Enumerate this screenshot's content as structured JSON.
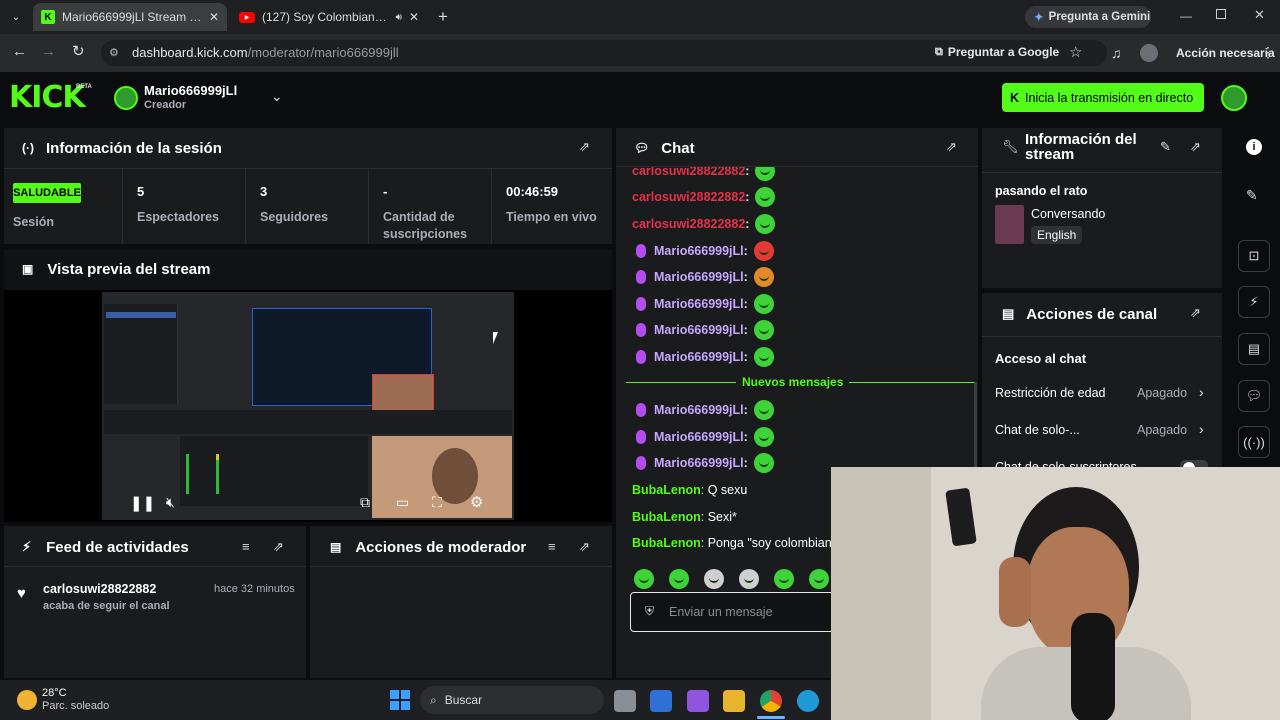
{
  "browser": {
    "tabs": [
      {
        "label": "Mario666999jLl Stream - Kick D"
      },
      {
        "label": "(127) Soy Colombiano -Silv"
      }
    ],
    "gemini": "Pregunta a Gemini",
    "url_host": "dashboard.kick.com",
    "url_path": "/moderator/mario666999jll",
    "ask_google": "Preguntar a Google",
    "action_needed": "Acción necesaria"
  },
  "header": {
    "logo": "KICK",
    "beta": "BETA",
    "channel": "Mario666999jLl",
    "role": "Creador",
    "go_live": "Inicia la transmisión en directo"
  },
  "session": {
    "title": "Información de la sesión",
    "badge": "SALUDABLE",
    "badge_label": "Sesión",
    "stats": [
      {
        "value": "5",
        "label": "Espectadores"
      },
      {
        "value": "3",
        "label": "Seguidores"
      },
      {
        "value": "-",
        "label": "Cantidad de suscripciones"
      },
      {
        "value": "00:46:59",
        "label": "Tiempo en vivo"
      }
    ]
  },
  "preview": {
    "title": "Vista previa del stream"
  },
  "activity": {
    "title": "Feed de actividades",
    "user": "carlosuwi28822882",
    "time": "hace 32 minutos",
    "action": "acaba de seguir el canal"
  },
  "modactions": {
    "title": "Acciones de moderador"
  },
  "chat": {
    "title": "Chat",
    "messages": [
      {
        "user": "carlosuwi28822882",
        "text": ":"
      },
      {
        "user": "carlosuwi28822882",
        "text": ":"
      },
      {
        "user": "carlosuwi28822882",
        "text": ":"
      },
      {
        "user": "Mario666999jLl",
        "text": ":"
      },
      {
        "user": "Mario666999jLl",
        "text": ":"
      },
      {
        "user": "Mario666999jLl",
        "text": ":"
      },
      {
        "user": "Mario666999jLl",
        "text": ":"
      },
      {
        "user": "Mario666999jLl",
        "text": ":"
      }
    ],
    "divider": "Nuevos mensajes",
    "new_messages": [
      {
        "user": "Mario666999jLl",
        "text": ":"
      },
      {
        "user": "Mario666999jLl",
        "text": ":"
      },
      {
        "user": "Mario666999jLl",
        "text": ":"
      },
      {
        "user": "BubaLenon",
        "text": ": Q sexu"
      },
      {
        "user": "BubaLenon",
        "text": ": Sexi*"
      },
      {
        "user": "BubaLenon",
        "text": ": Ponga \"soy colombianc"
      }
    ],
    "placeholder": "Enviar un mensaje"
  },
  "stream_info": {
    "title": "Información del stream",
    "stream_title": "pasando el rato",
    "category": "Conversando",
    "language": "English"
  },
  "channel_actions": {
    "title": "Acciones de canal",
    "section": "Acceso al chat",
    "rows": [
      {
        "label": "Restricción de edad",
        "value": "Apagado"
      },
      {
        "label": "Chat de solo-...",
        "value": "Apagado"
      },
      {
        "label": "Chat de solo-suscriptores",
        "value": ""
      }
    ]
  },
  "taskbar": {
    "temp": "28°C",
    "weather": "Parc. soleado",
    "search": "Buscar"
  },
  "colors": {
    "kick_green": "#53fc18",
    "chat_red": "#e8304a",
    "mod_purple": "#c9a6ff",
    "user_green": "#53fc18"
  }
}
